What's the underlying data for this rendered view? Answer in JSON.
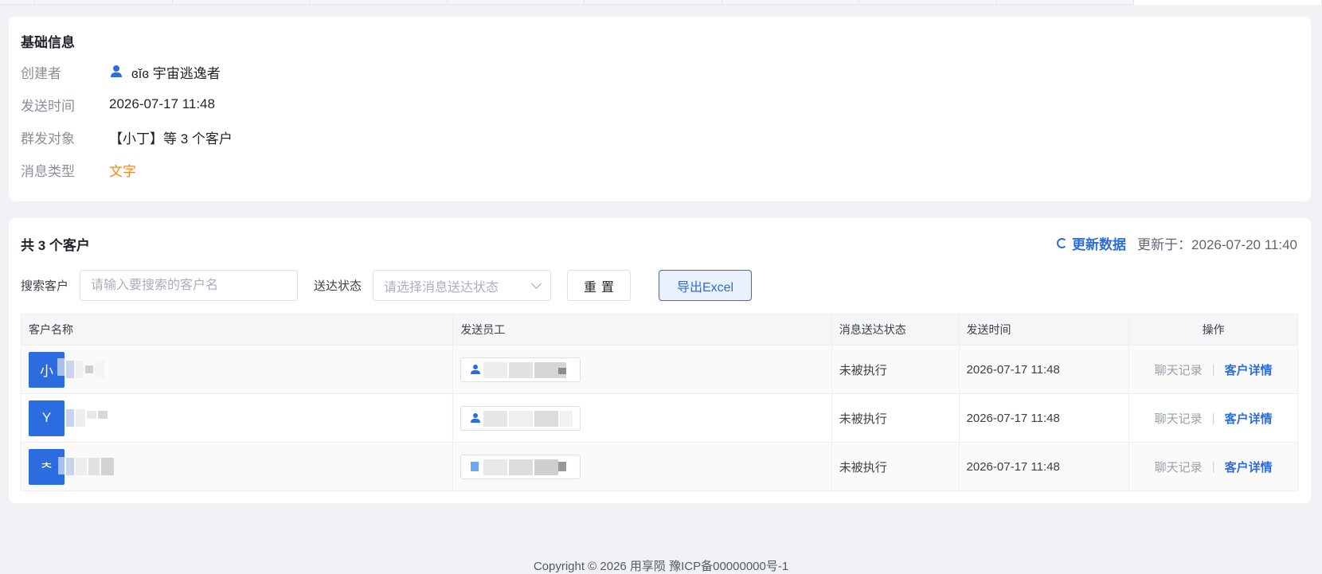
{
  "basic_info": {
    "title": "基础信息",
    "rows": [
      {
        "label": "创建者",
        "value": "ɞĭɞ 宇宙逃逸者"
      },
      {
        "label": "发送时间",
        "value": "2026-07-17 11:48"
      },
      {
        "label": "群发对象",
        "value": "【小丁】等 3 个客户"
      },
      {
        "label": "消息类型",
        "value": "文字"
      }
    ]
  },
  "customers": {
    "title": "共 3 个客户",
    "refresh_label": "更新数据",
    "updated_at": "更新于：2026-07-20 11:40",
    "search_label": "搜索客户",
    "search_placeholder": "请输入要搜索的客户名",
    "status_label": "送达状态",
    "status_placeholder": "请选择消息送达状态",
    "reset_label": "重置",
    "export_label": "导出Excel",
    "columns": [
      "客户名称",
      "发送员工",
      "消息送达状态",
      "发送时间",
      "操作"
    ],
    "rows": [
      {
        "avatar": "小",
        "status": "未被执行",
        "time": "2026-07-17 11:48",
        "chat": "聊天记录",
        "detail": "客户详情"
      },
      {
        "avatar": "Y",
        "status": "未被执行",
        "time": "2026-07-17 11:48",
        "chat": "聊天记录",
        "detail": "客户详情"
      },
      {
        "avatar": "ᄎ",
        "status": "未被执行",
        "time": "2026-07-17 11:48",
        "chat": "聊天记录",
        "detail": "客户详情"
      }
    ]
  },
  "footer": "Copyright © 2026 用享陨 豫ICP备00000000号-1",
  "colors": {
    "primary": "#2b6de0",
    "orange": "#f08a24"
  }
}
